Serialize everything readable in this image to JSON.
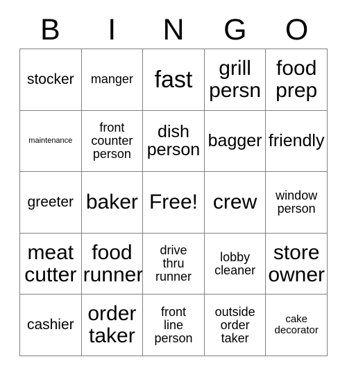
{
  "card": {
    "title": "Bingo Card",
    "header_letters": [
      "B",
      "I",
      "N",
      "G",
      "O"
    ],
    "free_space_label": "Free!",
    "colors": {
      "background": "#ffffff",
      "border": "#808080",
      "text": "#000000"
    },
    "grid": {
      "rows": 5,
      "columns": 5,
      "cells": [
        [
          {
            "text": "stocker",
            "size": "lg"
          },
          {
            "text": "manger",
            "size": "md"
          },
          {
            "text": "fast",
            "size": "huge"
          },
          {
            "text": "grill\npersn",
            "size": "xxl"
          },
          {
            "text": "food\nprep",
            "size": "xxl"
          }
        ],
        [
          {
            "text": "maintenance",
            "size": "xs"
          },
          {
            "text": "front\ncounter\nperson",
            "size": "md"
          },
          {
            "text": "dish\nperson",
            "size": "xl"
          },
          {
            "text": "bagger",
            "size": "xl"
          },
          {
            "text": "friendly",
            "size": "xl"
          }
        ],
        [
          {
            "text": "greeter",
            "size": "lg"
          },
          {
            "text": "baker",
            "size": "xxl"
          },
          {
            "text": "Free!",
            "size": "xxl"
          },
          {
            "text": "crew",
            "size": "xxl"
          },
          {
            "text": "window\nperson",
            "size": "md"
          }
        ],
        [
          {
            "text": "meat\ncutter",
            "size": "xxl"
          },
          {
            "text": "food\nrunner",
            "size": "xxl"
          },
          {
            "text": "drive\nthru\nrunner",
            "size": "md"
          },
          {
            "text": "lobby\ncleaner",
            "size": "md"
          },
          {
            "text": "store\nowner",
            "size": "xxl"
          }
        ],
        [
          {
            "text": "cashier",
            "size": "lg"
          },
          {
            "text": "order\ntaker",
            "size": "xxl"
          },
          {
            "text": "front\nline\nperson",
            "size": "md"
          },
          {
            "text": "outside\norder\ntaker",
            "size": "md"
          },
          {
            "text": "cake\ndecorator",
            "size": "sm"
          }
        ]
      ]
    }
  }
}
